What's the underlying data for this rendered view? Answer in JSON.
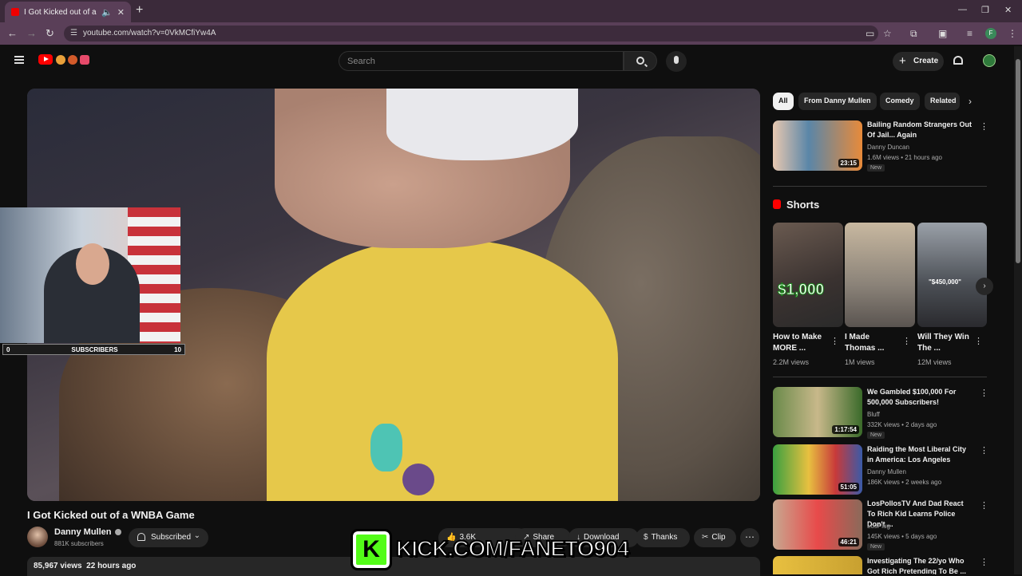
{
  "browser": {
    "tab_title": "I Got Kicked out of a WNBA Game",
    "url": "youtube.com/watch?v=0VkMCfiYw4A",
    "profile_initial": "F"
  },
  "header": {
    "search_placeholder": "Search",
    "create_label": "Create"
  },
  "overlay": {
    "sub_goal_start": "0",
    "sub_goal_label": "SUBSCRIBERS",
    "sub_goal_end": "10",
    "banner_text": "KICK.COM/FANETO904"
  },
  "video": {
    "title": "I Got Kicked out of a WNBA Game",
    "channel": "Danny Mullen",
    "subscribers": "881K subscribers",
    "subscribed_label": "Subscribed",
    "likes": "3.6K",
    "share_label": "Share",
    "download_label": "Download",
    "thanks_label": "Thanks",
    "clip_label": "Clip",
    "views": "85,967 views",
    "posted": "22 hours ago"
  },
  "chips": [
    "All",
    "From Danny Mullen",
    "Comedy",
    "Related"
  ],
  "shorts_heading": "Shorts",
  "recommended_top": {
    "title": "Bailing Random Strangers Out Of Jail... Again",
    "channel": "Danny Duncan",
    "meta": "1.6M views • 21 hours ago",
    "badge": "New",
    "duration": "23:15"
  },
  "shorts": [
    {
      "title": "How to Make MORE ...",
      "views": "2.2M views",
      "overlay": "$1,000"
    },
    {
      "title": "I Made Thomas ...",
      "views": "1M views",
      "overlay": ""
    },
    {
      "title": "Will They Win The ...",
      "views": "12M views",
      "overlay": "\"$450,000\""
    }
  ],
  "recommended": [
    {
      "title": "We Gambled $100,000 For 500,000 Subscribers!",
      "channel": "Bluff",
      "meta": "332K views • 2 days ago",
      "badge": "New",
      "duration": "1:17:54"
    },
    {
      "title": "Raiding the Most Liberal City in America: Los Angeles",
      "channel": "Danny Mullen",
      "meta": "186K views • 2 weeks ago",
      "badge": "",
      "duration": "51:05"
    },
    {
      "title": "LosPollosTV And Dad React To Rich Kid Learns Police Don't ...",
      "channel": "LosPlug",
      "meta": "145K views • 5 days ago",
      "badge": "New",
      "duration": "46:21"
    },
    {
      "title": "Investigating The 22/yo Who Got Rich Pretending To Be ...",
      "channel": "",
      "meta": "",
      "badge": "",
      "duration": ""
    }
  ]
}
